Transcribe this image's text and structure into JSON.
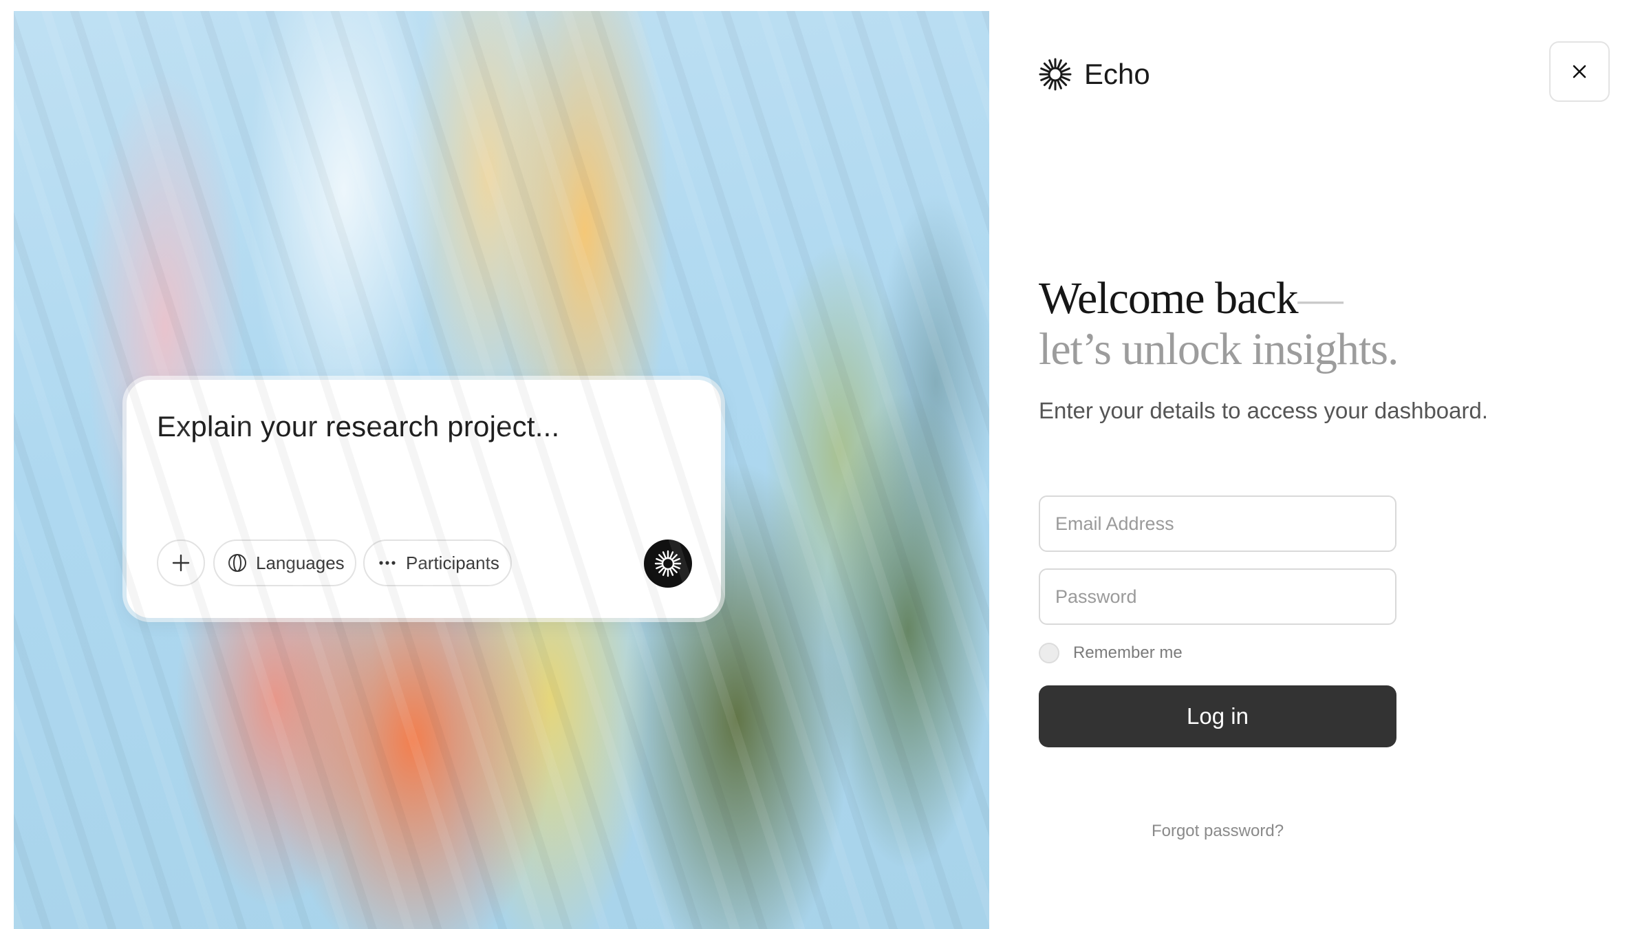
{
  "prompt": {
    "text": "Explain your research project...",
    "chips": {
      "add_icon": "plus-icon",
      "languages": "Languages",
      "languages_icon": "globe-icon",
      "participants": "Participants",
      "participants_icon": "ellipsis-icon"
    },
    "send_icon": "sunburst-icon"
  },
  "brand": {
    "name": "Echo",
    "logo_icon": "sunburst-logo-icon"
  },
  "close_icon": "close-icon",
  "login": {
    "headline_line1": "Welcome back",
    "headline_dash": "—",
    "headline_line2": "let’s unlock insights.",
    "subtitle": "Enter your details to access your dashboard.",
    "email_placeholder": "Email Address",
    "password_placeholder": "Password",
    "remember_label": "Remember me",
    "submit_label": "Log in",
    "forgot_label": "Forgot password?"
  },
  "colors": {
    "button_bg": "#333333",
    "sky": "#aed8f0",
    "orange": "#f67a46",
    "green": "#5e703e"
  }
}
